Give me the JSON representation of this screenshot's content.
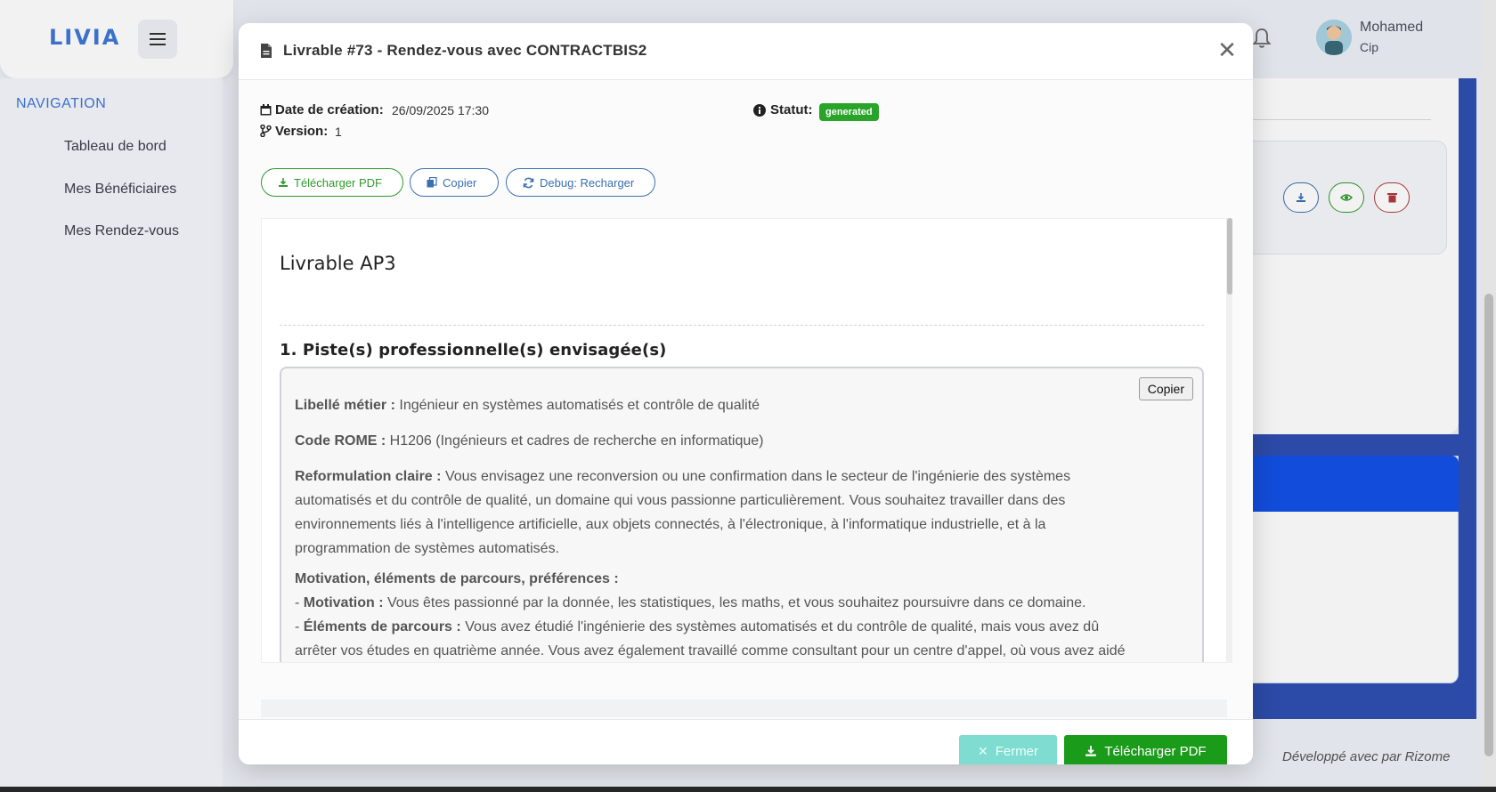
{
  "app": {
    "logo": "LIVIA",
    "nav_title": "NAVIGATION",
    "nav_items": [
      {
        "label": "Tableau de bord"
      },
      {
        "label": "Mes Bénéficiaires"
      },
      {
        "label": "Mes Rendez-vous"
      }
    ],
    "user": {
      "name": "Mohamed",
      "role": "Cip"
    },
    "footer": "Développé avec par Rizome"
  },
  "modal": {
    "title": "Livrable #73 - Rendez-vous avec CONTRACTBIS2",
    "meta": {
      "date_label": "Date de création:",
      "date_value": "26/09/2025 17:30",
      "version_label": "Version:",
      "version_value": "1",
      "status_label": "Statut:",
      "status_value": "generated"
    },
    "actions": {
      "download_pdf": "Télécharger PDF",
      "copy": "Copier",
      "debug_reload": "Debug: Recharger"
    },
    "document": {
      "title": "Livrable AP3",
      "section_title": "1. Piste(s) professionnelle(s) envisagée(s)",
      "copy_button": "Copier",
      "fields": {
        "libelle_label": "Libellé métier :",
        "libelle_value": "Ingénieur en systèmes automatisés et contrôle de qualité",
        "rome_label": "Code ROME :",
        "rome_value": "H1206 (Ingénieurs et cadres de recherche en informatique)",
        "reformulation_label": "Reformulation claire :",
        "reformulation_value": "Vous envisagez une reconversion ou une confirmation dans le secteur de l'ingénierie des systèmes automatisés et du contrôle de qualité, un domaine qui vous passionne particulièrement. Vous souhaitez travailler dans des environnements liés à l'intelligence artificielle, aux objets connectés, à l'électronique, à l'informatique industrielle, et à la programmation de systèmes automatisés.",
        "motivation_heading": "Motivation, éléments de parcours, préférences :",
        "motivation_label": "Motivation :",
        "motivation_value": "Vous êtes passionné par la donnée, les statistiques, les maths, et vous souhaitez poursuivre dans ce domaine.",
        "parcours_label": "Éléments de parcours :",
        "parcours_value": "Vous avez étudié l'ingénierie des systèmes automatisés et du contrôle de qualité, mais vous avez dû arrêter vos études en quatrième année. Vous avez également travaillé comme consultant pour un centre d'appel, où vous avez aidé"
      }
    },
    "footer": {
      "close": "Fermer",
      "download_pdf": "Télécharger PDF"
    }
  }
}
